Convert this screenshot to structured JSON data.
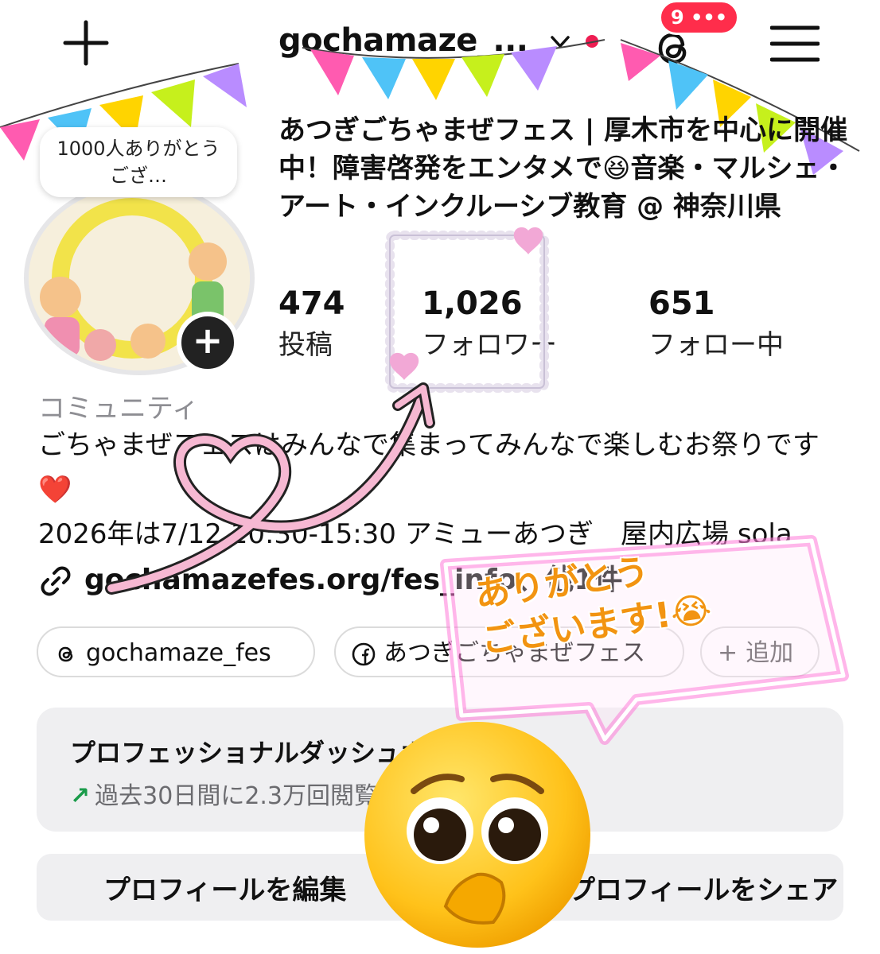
{
  "header": {
    "username": "gochamaze_...",
    "notification_count": "9 •••"
  },
  "profile": {
    "note": "1000人ありがとうござ…",
    "full_name": "あつぎごちゃまぜフェス | 厚木市を中心に開催中！障害啓発をエンタメで😆音楽・マルシェ・アート・インクルーシブ教育 @ 神奈川県",
    "stats": [
      {
        "value": "474",
        "label": "投稿"
      },
      {
        "value": "1,026",
        "label": "フォロワー"
      },
      {
        "value": "651",
        "label": "フォロー中"
      }
    ],
    "category": "コミュニティ",
    "bio_line1": "ごちゃまぜフェスはみんなで集まってみんなで楽しむお祭りです❤️",
    "bio_line2": "2026年は7/12 10:30-15:30 アミューあつぎ　屋内広場 sola",
    "link": "gochamazefes.org/fes_info、他1件"
  },
  "chips": {
    "threads": "gochamaze_fes",
    "facebook": "あつぎごちゃまぜフェス",
    "add": "追加"
  },
  "dashboard": {
    "title": "プロフェッショナルダッシュボード",
    "subtitle": "過去30日間に2.3万回閲覧されました。"
  },
  "buttons": {
    "edit": "プロフィールを編集",
    "share": "プロフィールをシェア"
  },
  "sticker": {
    "line1": "ありがとう",
    "line2": "ございます!😭"
  },
  "colors": {
    "accent_red": "#ff2d4b",
    "sticker_orange": "#f29411",
    "neon_pink": "#ff7bd9",
    "trend_green": "#1a9b4a"
  }
}
